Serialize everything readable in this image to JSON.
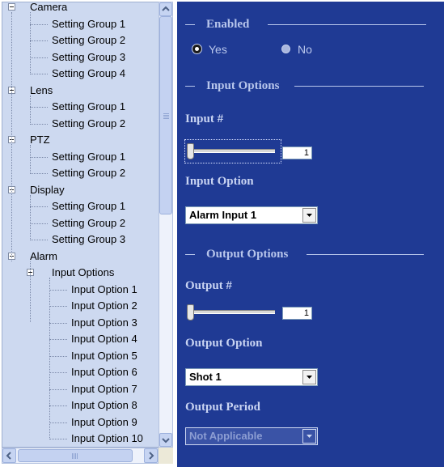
{
  "tree": {
    "items": [
      {
        "label": "Camera",
        "level": 0
      },
      {
        "label": "Setting Group 1",
        "level": 1
      },
      {
        "label": "Setting Group 2",
        "level": 1
      },
      {
        "label": "Setting Group 3",
        "level": 1
      },
      {
        "label": "Setting Group 4",
        "level": 1
      },
      {
        "label": "Lens",
        "level": 0
      },
      {
        "label": "Setting Group 1",
        "level": 1
      },
      {
        "label": "Setting Group 2",
        "level": 1
      },
      {
        "label": "PTZ",
        "level": 0
      },
      {
        "label": "Setting Group 1",
        "level": 1
      },
      {
        "label": "Setting Group 2",
        "level": 1
      },
      {
        "label": "Display",
        "level": 0
      },
      {
        "label": "Setting Group 1",
        "level": 1
      },
      {
        "label": "Setting Group 2",
        "level": 1
      },
      {
        "label": "Setting Group 3",
        "level": 1
      },
      {
        "label": "Alarm",
        "level": 0
      },
      {
        "label": "Input Options",
        "level": 1
      },
      {
        "label": "Input Option 1",
        "level": 2
      },
      {
        "label": "Input Option 2",
        "level": 2
      },
      {
        "label": "Input Option 3",
        "level": 2
      },
      {
        "label": "Input Option 4",
        "level": 2
      },
      {
        "label": "Input Option 5",
        "level": 2
      },
      {
        "label": "Input Option 6",
        "level": 2
      },
      {
        "label": "Input Option 7",
        "level": 2
      },
      {
        "label": "Input Option 8",
        "level": 2
      },
      {
        "label": "Input Option 9",
        "level": 2
      },
      {
        "label": "Input Option 10",
        "level": 2
      }
    ]
  },
  "enabled": {
    "header": "Enabled",
    "yes_label": "Yes",
    "no_label": "No",
    "selected": "Yes"
  },
  "input_options": {
    "header": "Input Options",
    "input_number_label": "Input #",
    "input_number_value": "1",
    "input_option_label": "Input Option",
    "input_option_value": "Alarm Input 1"
  },
  "output_options": {
    "header": "Output Options",
    "output_number_label": "Output #",
    "output_number_value": "1",
    "output_option_label": "Output Option",
    "output_option_value": "Shot 1",
    "output_period_label": "Output Period",
    "output_period_value": "Not Applicable"
  },
  "icons": {
    "tree_expander": "minus-box-icon",
    "scroll_up": "arrow-up-icon",
    "scroll_down": "arrow-down-icon",
    "scroll_left": "arrow-left-icon",
    "scroll_right": "arrow-right-icon",
    "dropdown": "chevron-down-icon"
  },
  "colors": {
    "panel_background": "#1f3a94",
    "tree_background": "#cdd9f0"
  }
}
